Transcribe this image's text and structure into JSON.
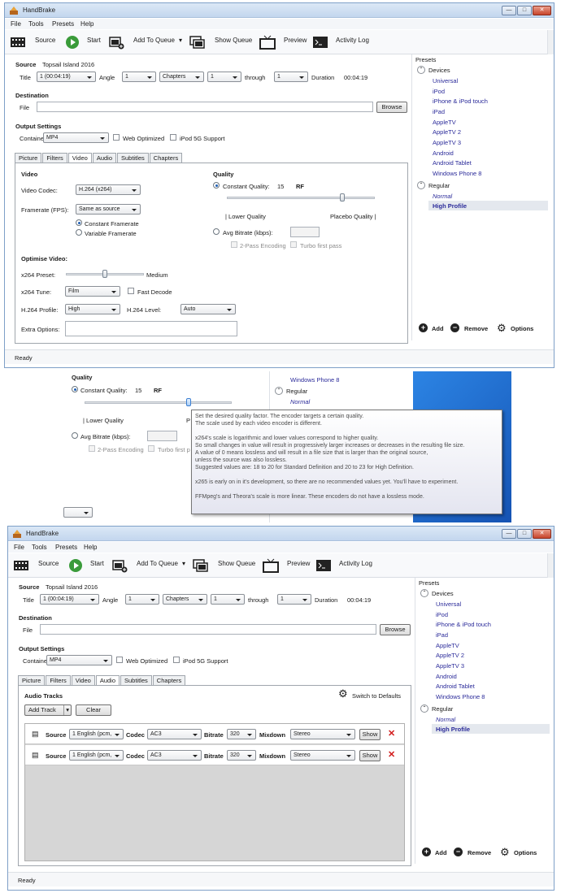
{
  "window": {
    "title": "HandBrake",
    "menu": [
      "File",
      "Tools",
      "Presets",
      "Help"
    ],
    "min": "—",
    "max": "□",
    "close": "✕"
  },
  "toolbar": {
    "source": "Source",
    "start": "Start",
    "add_to_queue": "Add To Queue",
    "show_queue": "Show Queue",
    "preview": "Preview",
    "activity_log": "Activity Log"
  },
  "source": {
    "label": "Source",
    "name": "Topsail Island 2016",
    "title_label": "Title",
    "title_value": "1 (00:04:19)",
    "angle_label": "Angle",
    "angle_value": "1",
    "range_mode": "Chapters",
    "range_start": "1",
    "through_label": "through",
    "range_end": "1",
    "duration_label": "Duration",
    "duration_value": "00:04:19"
  },
  "destination": {
    "label": "Destination",
    "file_label": "File",
    "file_value": "",
    "browse": "Browse"
  },
  "output": {
    "label": "Output Settings",
    "container_label": "Container",
    "container_value": "MP4",
    "web_optimized": "Web Optimized",
    "ipod": "iPod 5G Support"
  },
  "tabs": [
    "Picture",
    "Filters",
    "Video",
    "Audio",
    "Subtitles",
    "Chapters"
  ],
  "video": {
    "heading": "Video",
    "codec_label": "Video Codec:",
    "codec_value": "H.264 (x264)",
    "framerate_label": "Framerate (FPS):",
    "framerate_value": "Same as source",
    "constant_framerate": "Constant Framerate",
    "variable_framerate": "Variable Framerate",
    "quality_heading": "Quality",
    "constant_quality": "Constant Quality:",
    "cq_value": "15",
    "cq_unit": "RF",
    "slider_position": 0.78,
    "lower_quality": "| Lower Quality",
    "placebo_quality": "Placebo Quality |",
    "avg_bitrate": "Avg Bitrate (kbps):",
    "two_pass": "2-Pass Encoding",
    "turbo": "Turbo first pass",
    "optimise_heading": "Optimise Video:",
    "preset_label": "x264 Preset:",
    "preset_value": "Medium",
    "preset_position": 0.5,
    "tune_label": "x264 Tune:",
    "tune_value": "Film",
    "fast_decode": "Fast Decode",
    "profile_label": "H.264 Profile:",
    "profile_value": "High",
    "level_label": "H.264 Level:",
    "level_value": "Auto",
    "extra_label": "Extra Options:"
  },
  "presets": {
    "title": "Presets",
    "devices_label": "Devices",
    "devices": [
      "Universal",
      "iPod",
      "iPhone & iPod touch",
      "iPad",
      "AppleTV",
      "AppleTV 2",
      "AppleTV 3",
      "Android",
      "Android Tablet",
      "Windows Phone 8"
    ],
    "regular_label": "Regular",
    "regular": [
      "Normal",
      "High Profile"
    ],
    "selected": "High Profile",
    "add": "Add",
    "remove": "Remove",
    "options": "Options"
  },
  "status": "Ready",
  "tooltip": {
    "lines": [
      "Set the desired quality factor. The encoder targets a certain quality.",
      "The scale used by each video encoder is different.",
      "",
      "x264's scale is logarithmic and lower values correspond to higher quality.",
      "So small changes in value will result in progressively larger increases or decreases in the resulting file size.",
      "A value of 0 means lossless and will result in a file size that is larger than the original source,",
      "unless the source was also lossless.",
      "Suggested values are: 18 to 20 for Standard Definition and 20 to 23 for High Definition.",
      "",
      "x265 is early on in it's development, so there are no recommended values yet. You'll have to experiment.",
      "",
      "FFMpeg's and Theora's scale is more linear. These encoders do not have a lossless mode."
    ],
    "crop_preset_item": "Windows Phone 8",
    "crop_regular": "Regular",
    "crop_normal": "Normal",
    "crop_placebo_fragment": "P",
    "crop_turbo_fragment": "Turbo first p"
  },
  "audio": {
    "tracks_heading": "Audio Tracks",
    "add_track": "Add Track",
    "clear": "Clear",
    "switch_defaults": "Switch to Defaults",
    "rows": [
      {
        "source_label": "Source",
        "source": "1 English (pcm,",
        "codec_label": "Codec",
        "codec": "AC3",
        "bitrate_label": "Bitrate",
        "bitrate": "320",
        "mixdown_label": "Mixdown",
        "mixdown": "Stereo",
        "show": "Show"
      },
      {
        "source_label": "Source",
        "source": "1 English (pcm,",
        "codec_label": "Codec",
        "codec": "AC3",
        "bitrate_label": "Bitrate",
        "bitrate": "320",
        "mixdown_label": "Mixdown",
        "mixdown": "Stereo",
        "show": "Show"
      }
    ]
  },
  "colors": {
    "accent": "#1f5fb4",
    "preset_text": "#2b2b9a",
    "desktop_blue": "#1d6fd6"
  }
}
